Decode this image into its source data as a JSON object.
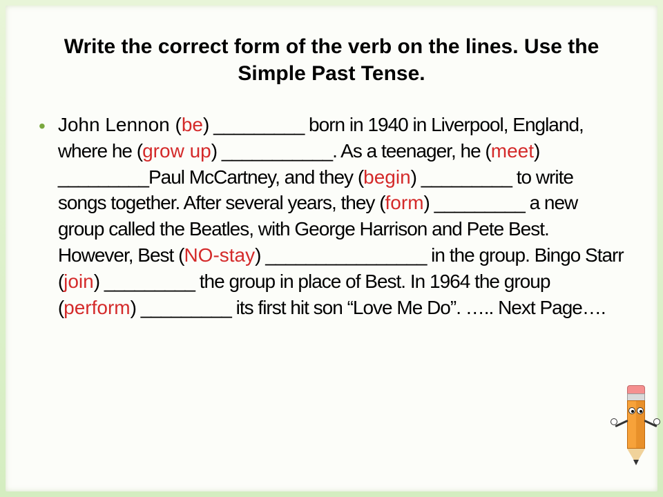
{
  "title": "Write the correct form of the verb on the lines. Use the Simple Past Tense.",
  "exercise": {
    "segments": [
      {
        "t": "John Lennon ("
      },
      {
        "t": "be",
        "verb": true
      },
      {
        "t": ") _________ born in 1940 in Liverpool, England, where he ("
      },
      {
        "t": "grow up",
        "verb": true
      },
      {
        "t": ") ___________. As a teenager, he ("
      },
      {
        "t": "meet",
        "verb": true
      },
      {
        "t": ") _________Paul McCartney, and they ("
      },
      {
        "t": "begin",
        "verb": true
      },
      {
        "t": ") _________ to write songs together. After several years, they ("
      },
      {
        "t": "form",
        "verb": true
      },
      {
        "t": ") _________ a new group called the Beatles, with George Harrison and Pete Best. However, Best ("
      },
      {
        "t": "NO-stay",
        "verb": true
      },
      {
        "t": ") ________________ in the group. Bingo Starr ("
      },
      {
        "t": "join",
        "verb": true
      },
      {
        "t": ") _________ the group in place of Best. In 1964 the group ("
      },
      {
        "t": "perform",
        "verb": true
      },
      {
        "t": ") _________ its first hit son “Love Me Do”. ….. Next Page…."
      }
    ]
  },
  "bullet_glyph": "•"
}
